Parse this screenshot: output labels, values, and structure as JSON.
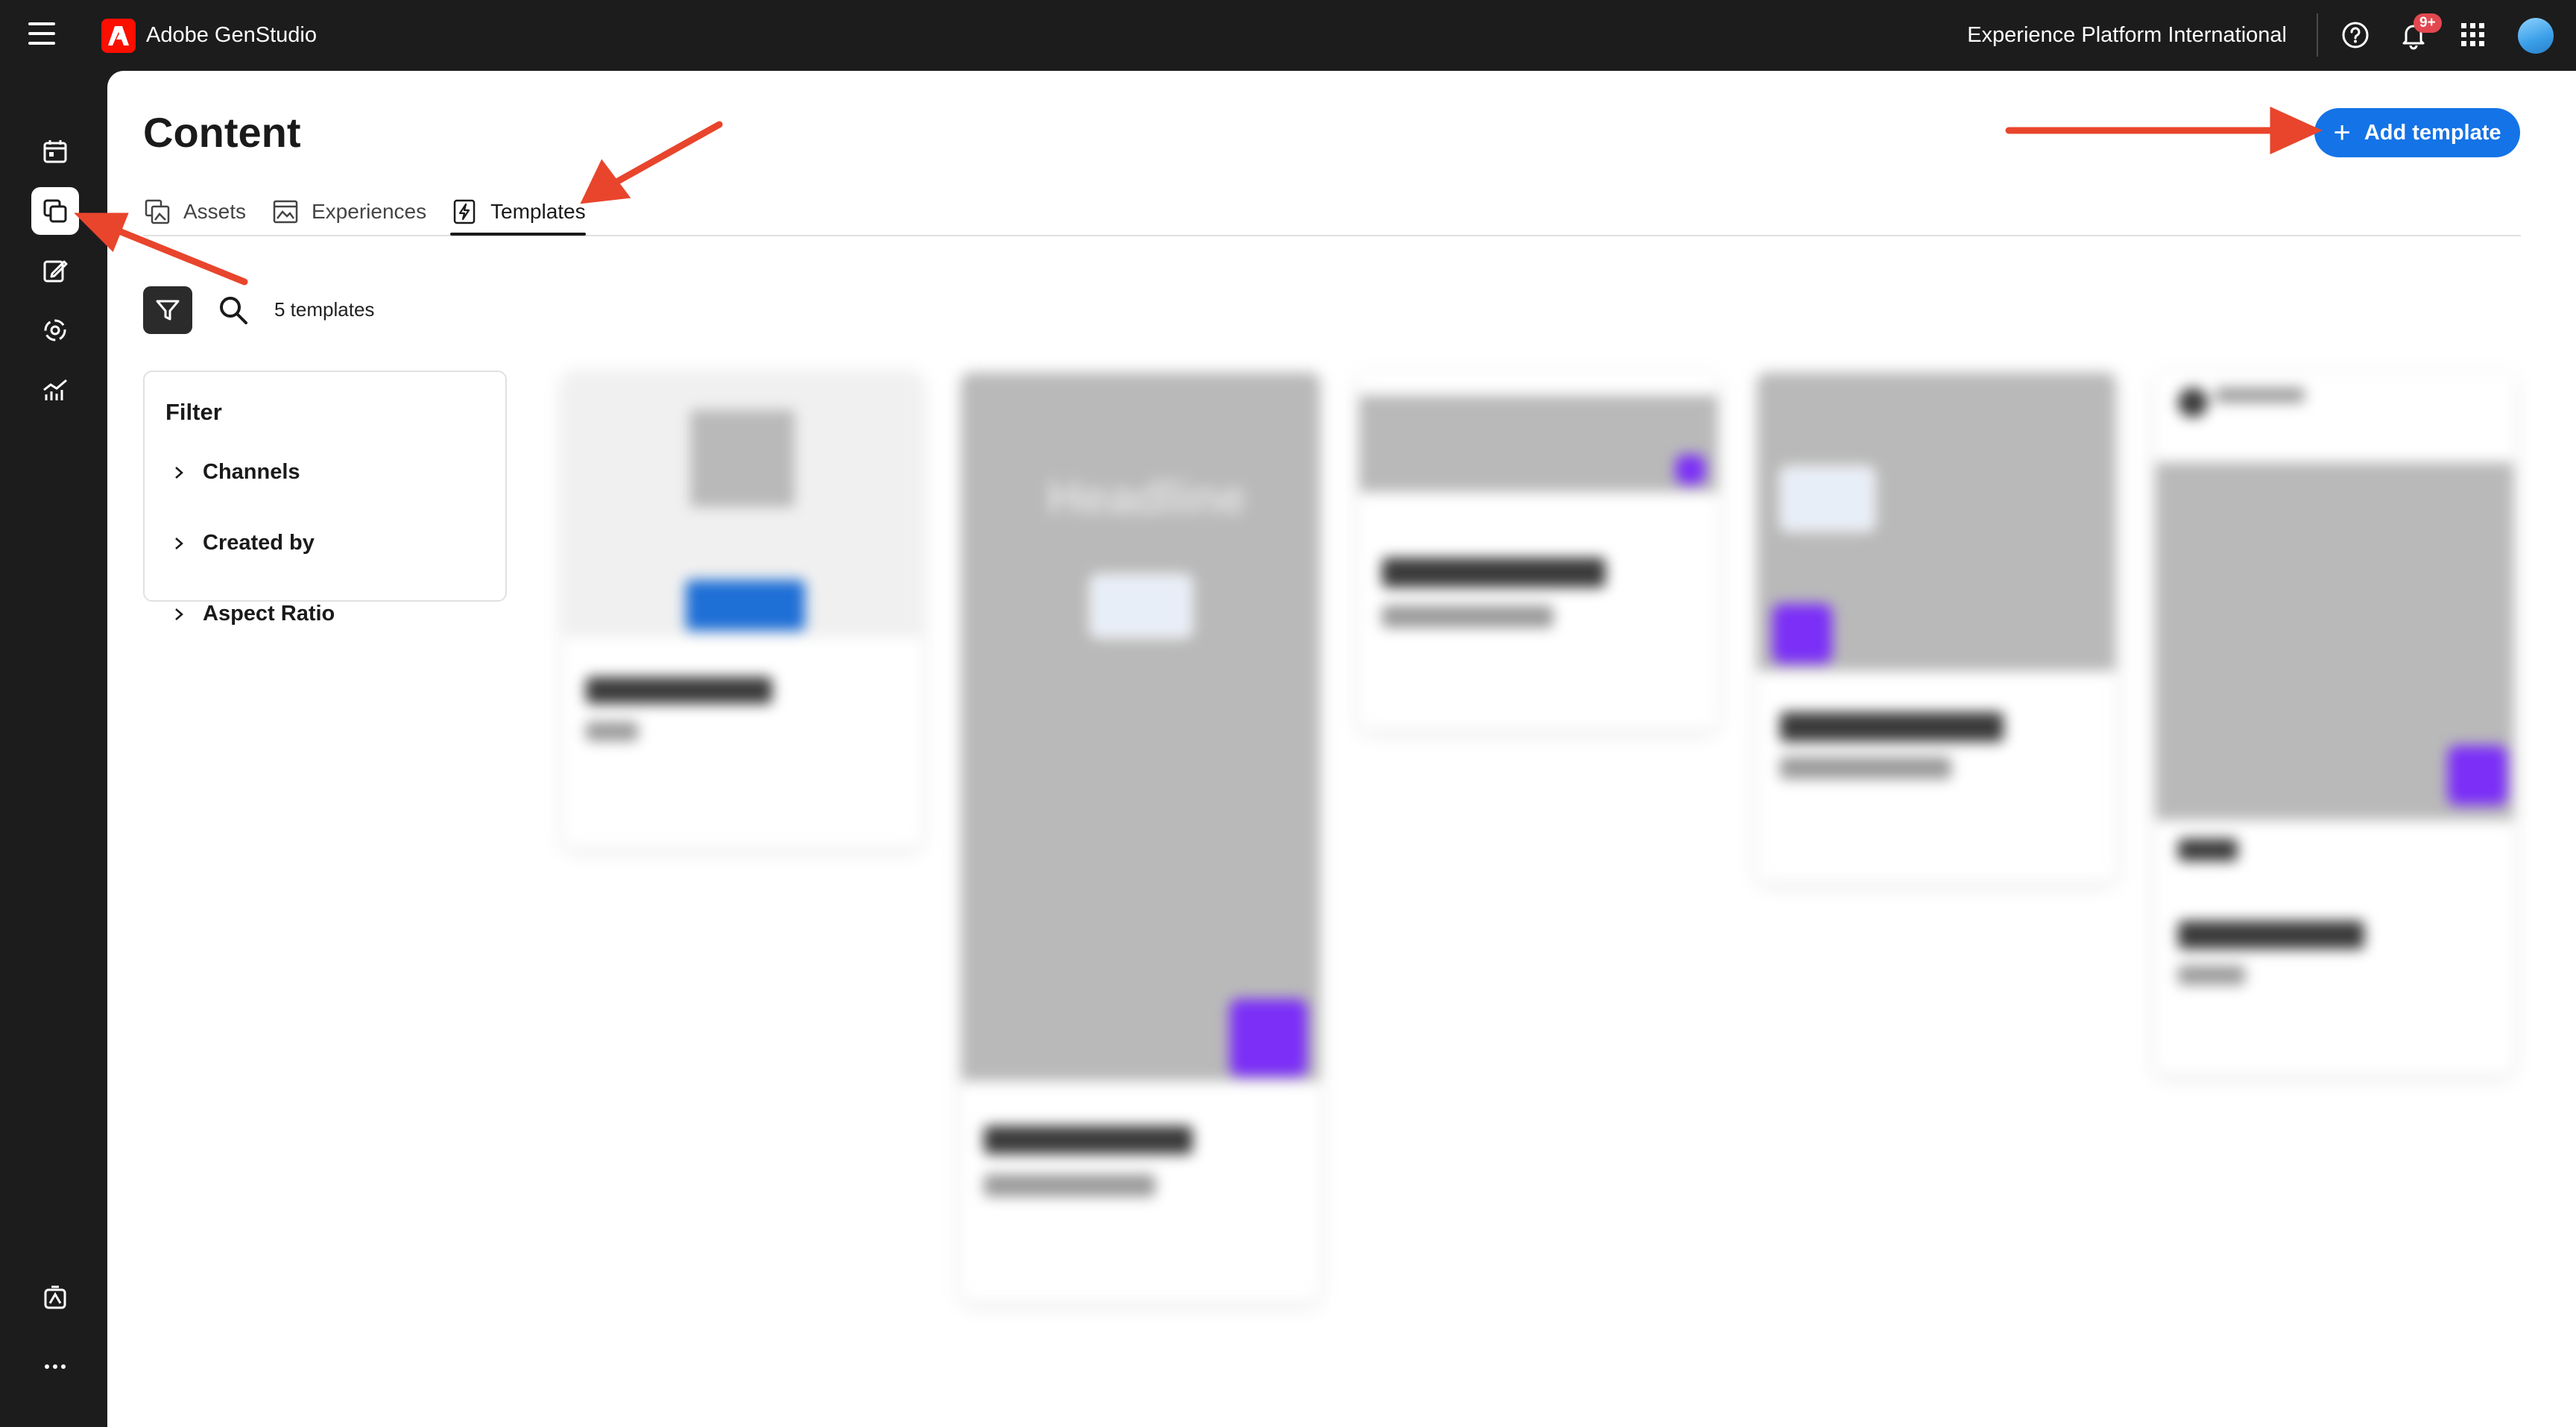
{
  "app": {
    "title": "Adobe GenStudio",
    "org": "Experience Platform International",
    "notification_count": "9+"
  },
  "page": {
    "title": "Content",
    "add_button_label": "Add template"
  },
  "tabs": [
    {
      "label": "Assets",
      "icon": "assets-icon"
    },
    {
      "label": "Experiences",
      "icon": "experiences-icon"
    },
    {
      "label": "Templates",
      "icon": "templates-icon",
      "active": true
    }
  ],
  "toolbar": {
    "count_label": "5 templates"
  },
  "filter": {
    "title": "Filter",
    "groups": [
      {
        "label": "Channels"
      },
      {
        "label": "Created by"
      },
      {
        "label": "Aspect Ratio"
      }
    ]
  },
  "templates_blurred": {
    "headline_placeholder": "Headline"
  },
  "colors": {
    "accent": "#1473e6",
    "annotation": "#e8452c",
    "rail_bg": "#1c1c1c",
    "badge": "#e34850"
  }
}
